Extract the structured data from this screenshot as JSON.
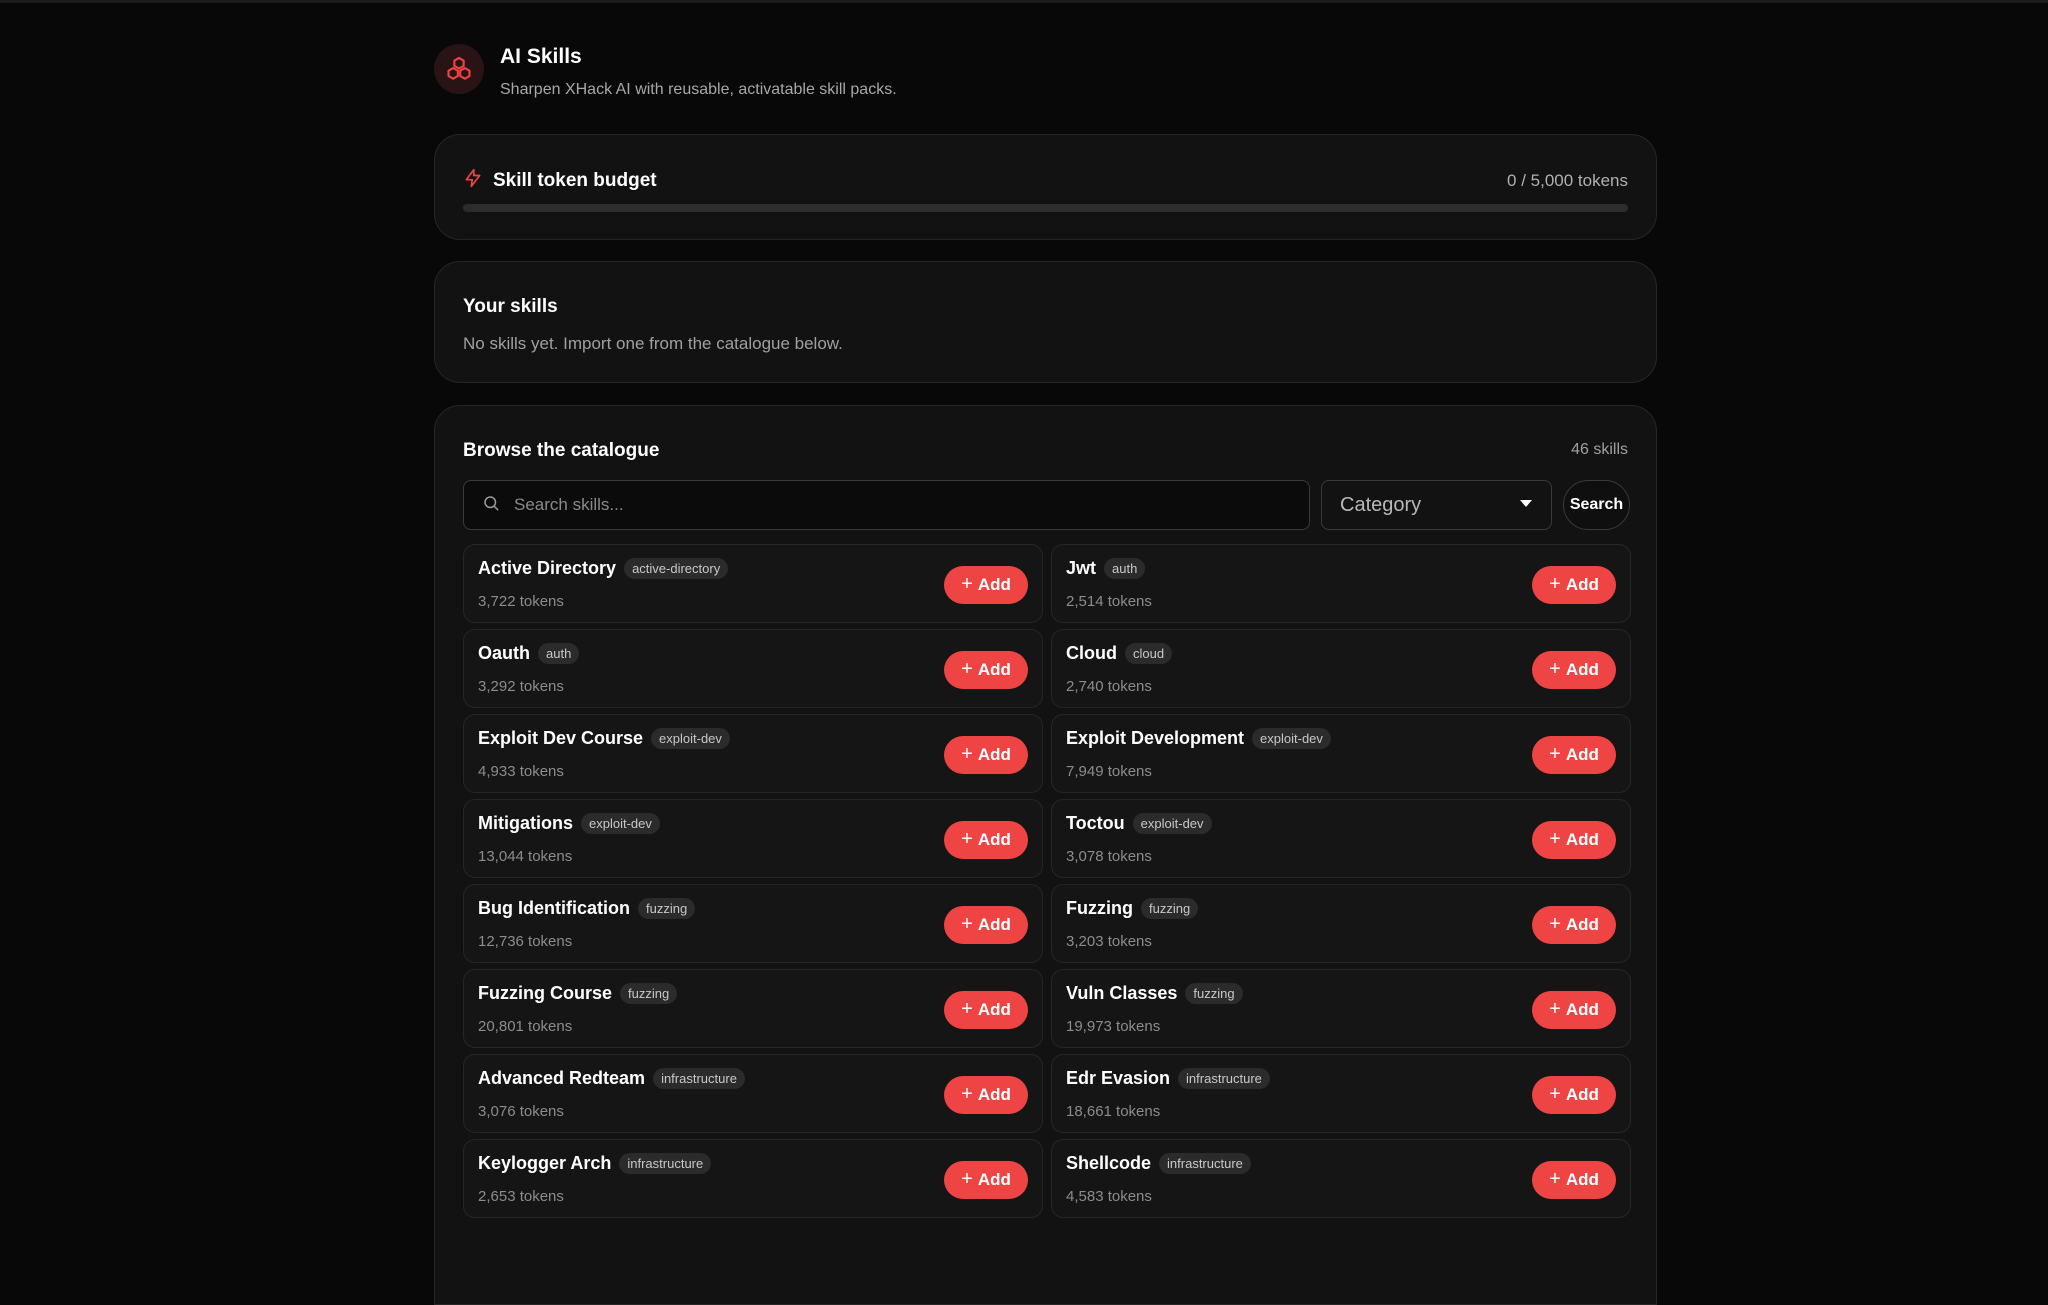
{
  "header": {
    "title": "AI Skills",
    "subtitle": "Sharpen XHack AI with reusable, activatable skill packs.",
    "logo_icon": "cubes-icon",
    "accent_color": "#ef4444"
  },
  "budget": {
    "title": "Skill token budget",
    "value_text": "0 / 5,000 tokens",
    "progress_fraction": 0,
    "icon": "lightning-icon"
  },
  "your_skills": {
    "title": "Your skills",
    "empty_text": "No skills yet. Import one from the catalogue below."
  },
  "catalogue": {
    "title": "Browse the catalogue",
    "count": "46 skills",
    "search_placeholder": "Search skills...",
    "search_value": "",
    "category_label": "Category",
    "search_button": "Search",
    "add_label": "Add",
    "skills": [
      {
        "name": "Active Directory",
        "tag": "active-directory",
        "tokens": "3,722 tokens"
      },
      {
        "name": "Jwt",
        "tag": "auth",
        "tokens": "2,514 tokens"
      },
      {
        "name": "Oauth",
        "tag": "auth",
        "tokens": "3,292 tokens"
      },
      {
        "name": "Cloud",
        "tag": "cloud",
        "tokens": "2,740 tokens"
      },
      {
        "name": "Exploit Dev Course",
        "tag": "exploit-dev",
        "tokens": "4,933 tokens"
      },
      {
        "name": "Exploit Development",
        "tag": "exploit-dev",
        "tokens": "7,949 tokens"
      },
      {
        "name": "Mitigations",
        "tag": "exploit-dev",
        "tokens": "13,044 tokens"
      },
      {
        "name": "Toctou",
        "tag": "exploit-dev",
        "tokens": "3,078 tokens"
      },
      {
        "name": "Bug Identification",
        "tag": "fuzzing",
        "tokens": "12,736 tokens"
      },
      {
        "name": "Fuzzing",
        "tag": "fuzzing",
        "tokens": "3,203 tokens"
      },
      {
        "name": "Fuzzing Course",
        "tag": "fuzzing",
        "tokens": "20,801 tokens"
      },
      {
        "name": "Vuln Classes",
        "tag": "fuzzing",
        "tokens": "19,973 tokens"
      },
      {
        "name": "Advanced Redteam",
        "tag": "infrastructure",
        "tokens": "3,076 tokens"
      },
      {
        "name": "Edr Evasion",
        "tag": "infrastructure",
        "tokens": "18,661 tokens"
      },
      {
        "name": "Keylogger Arch",
        "tag": "infrastructure",
        "tokens": "2,653 tokens"
      },
      {
        "name": "Shellcode",
        "tag": "infrastructure",
        "tokens": "4,583 tokens"
      }
    ]
  }
}
